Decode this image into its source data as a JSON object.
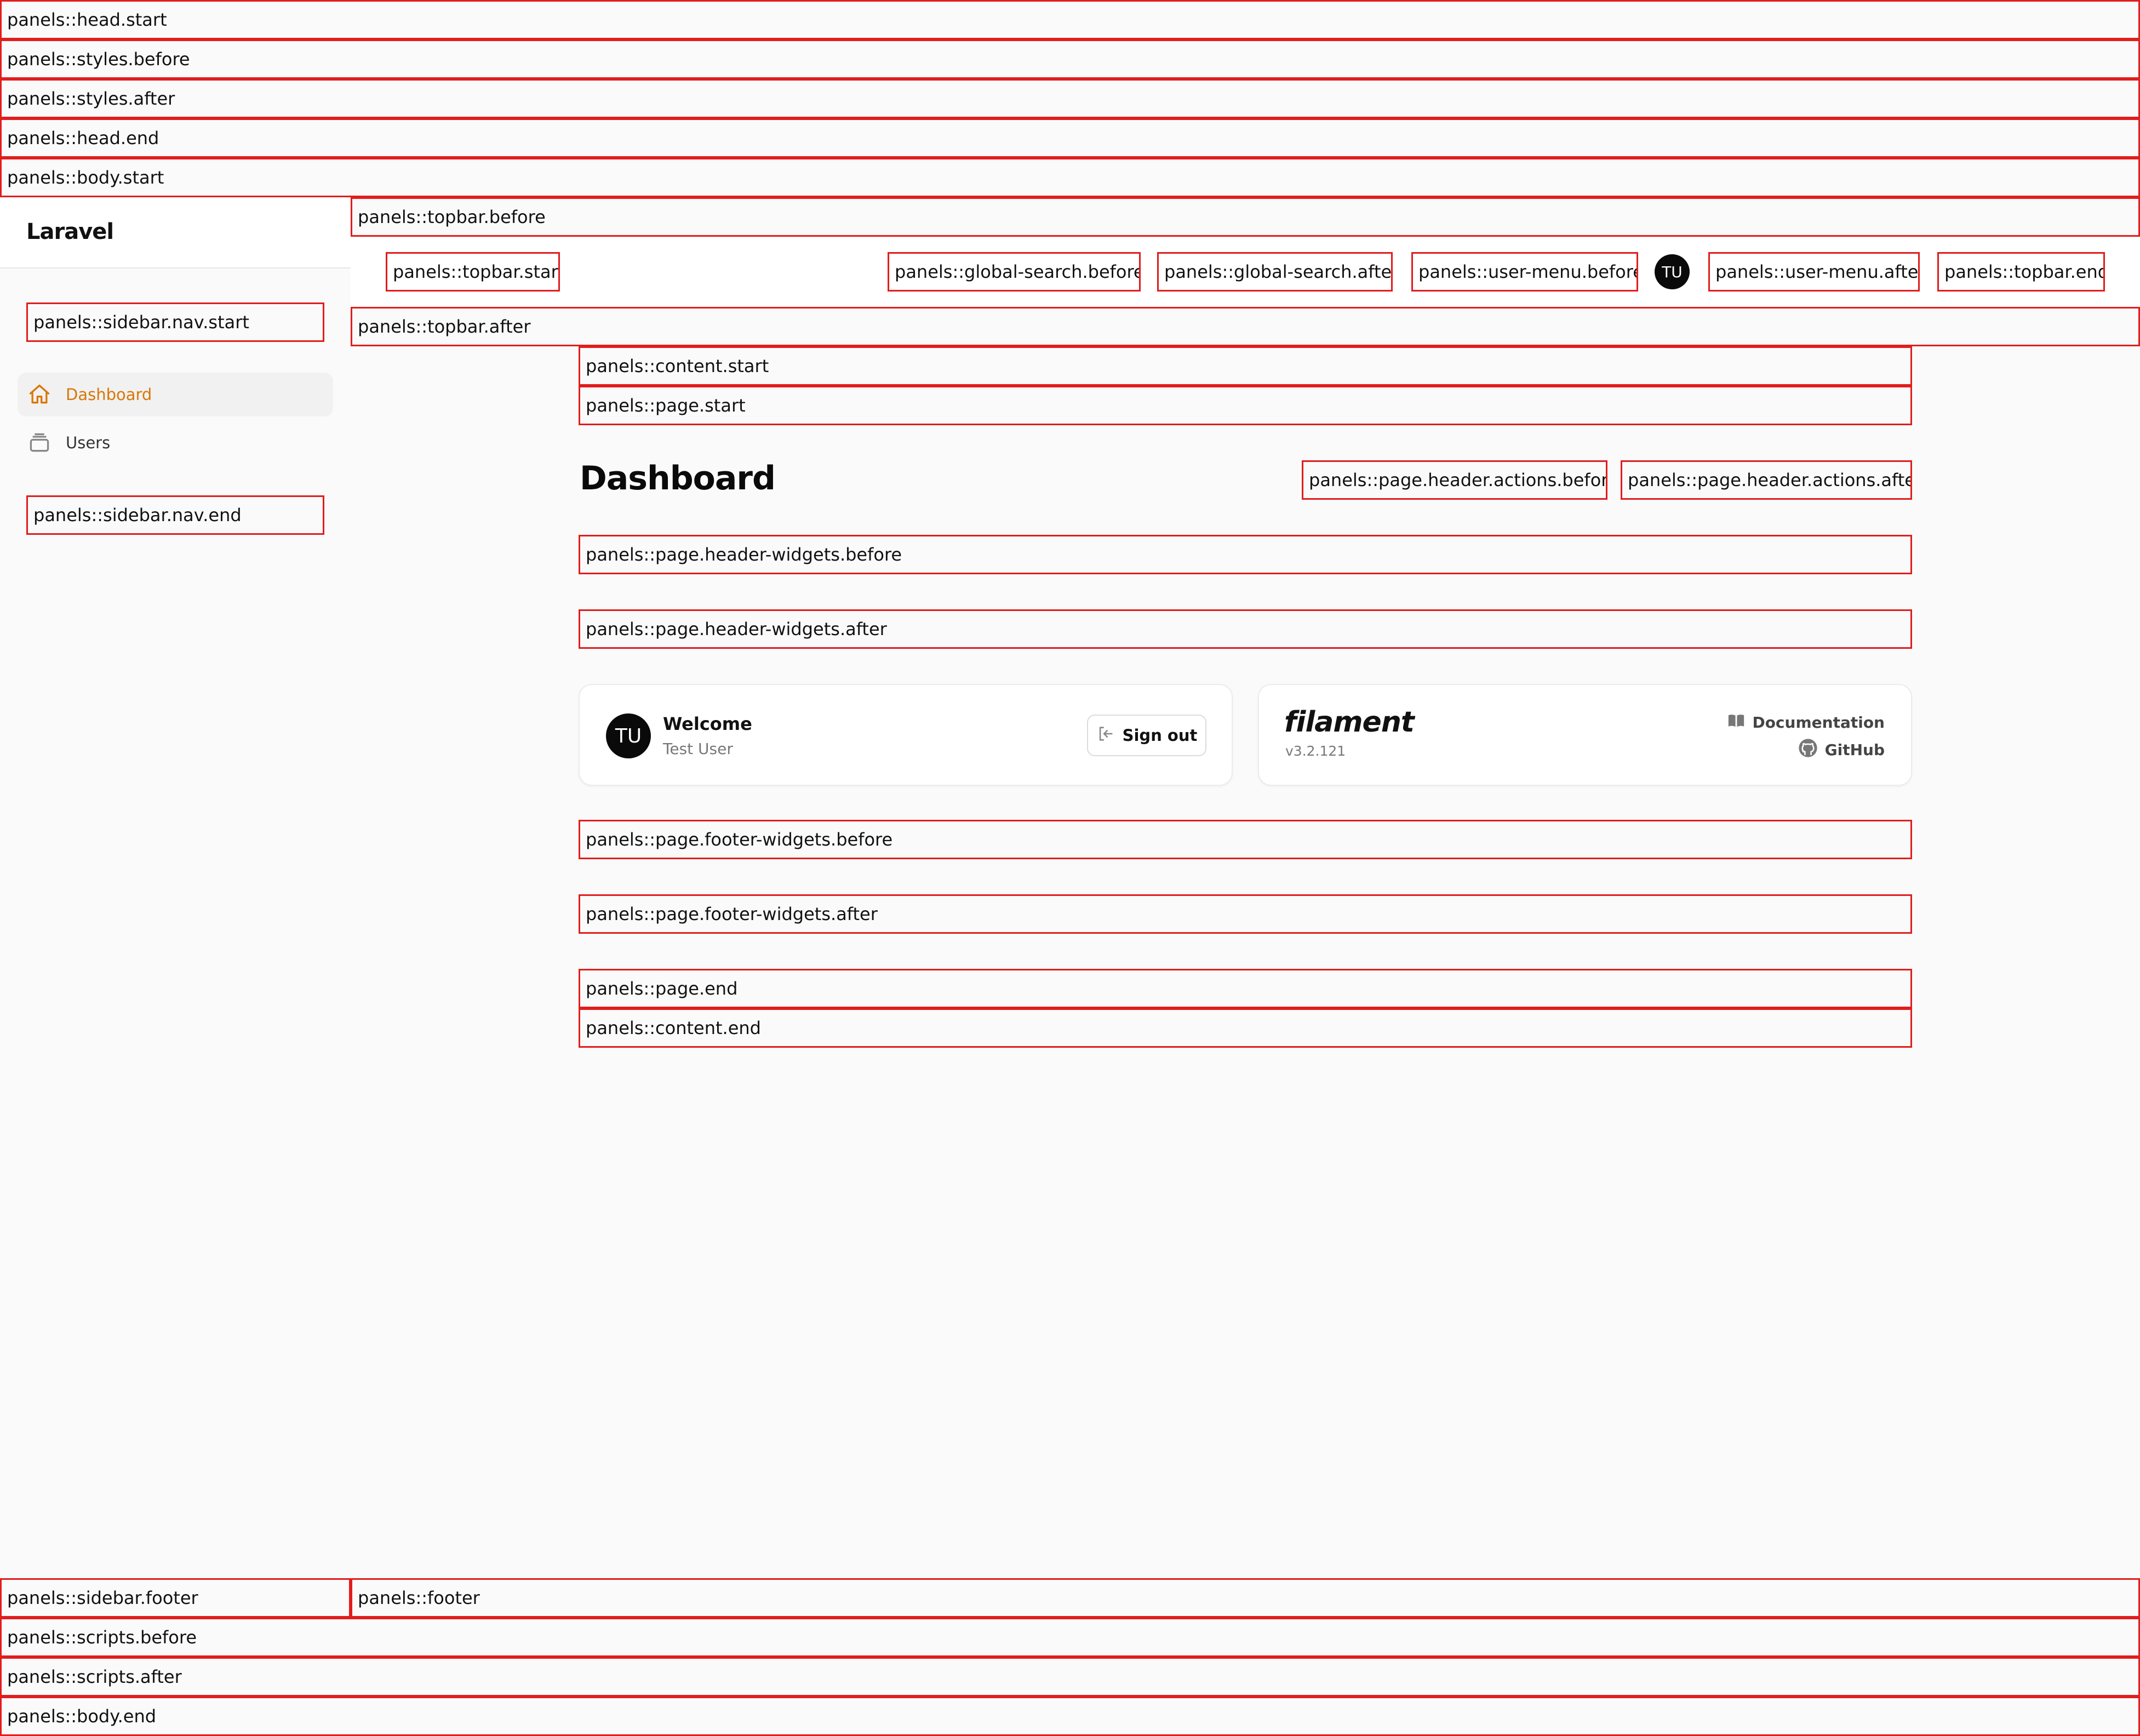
{
  "hooks": {
    "head_start": "panels::head.start",
    "styles_before": "panels::styles.before",
    "styles_after": "panels::styles.after",
    "head_end": "panels::head.end",
    "body_start": "panels::body.start",
    "topbar_before": "panels::topbar.before",
    "topbar_start": "panels::topbar.start",
    "global_search_before": "panels::global-search.before",
    "global_search_after": "panels::global-search.after",
    "user_menu_before": "panels::user-menu.before",
    "user_menu_after": "panels::user-menu.after",
    "topbar_end": "panels::topbar.end",
    "topbar_after": "panels::topbar.after",
    "sidebar_nav_start": "panels::sidebar.nav.start",
    "sidebar_nav_end": "panels::sidebar.nav.end",
    "content_start": "panels::content.start",
    "page_start": "panels::page.start",
    "page_header_actions_before": "panels::page.header.actions.before",
    "page_header_actions_after": "panels::page.header.actions.after",
    "page_header_widgets_before": "panels::page.header-widgets.before",
    "page_header_widgets_after": "panels::page.header-widgets.after",
    "page_footer_widgets_before": "panels::page.footer-widgets.before",
    "page_footer_widgets_after": "panels::page.footer-widgets.after",
    "page_end": "panels::page.end",
    "content_end": "panels::content.end",
    "sidebar_footer": "panels::sidebar.footer",
    "footer": "panels::footer",
    "scripts_before": "panels::scripts.before",
    "scripts_after": "panels::scripts.after",
    "body_end": "panels::body.end"
  },
  "brand": "Laravel",
  "user_initials": "TU",
  "sidebar": {
    "items": [
      {
        "label": "Dashboard",
        "icon": "home-icon",
        "active": true
      },
      {
        "label": "Users",
        "icon": "collection-icon",
        "active": false
      }
    ]
  },
  "page": {
    "title": "Dashboard"
  },
  "account_widget": {
    "initials": "TU",
    "title": "Welcome",
    "user_name": "Test User",
    "sign_out_label": "Sign out"
  },
  "filament_widget": {
    "logo": "filament",
    "version": "v3.2.121",
    "documentation_label": "Documentation",
    "github_label": "GitHub"
  },
  "colors": {
    "accent": "#d97706",
    "hook_border": "#e11d1d",
    "background": "#fafafa"
  }
}
